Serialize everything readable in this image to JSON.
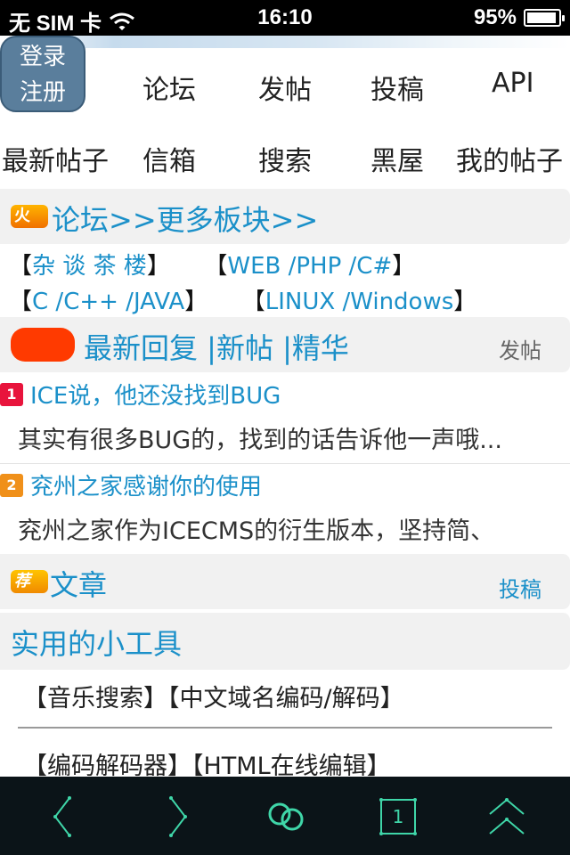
{
  "status": {
    "carrier": "无 SIM 卡",
    "time": "16:10",
    "battery": "95%",
    "battery_level": 0.95
  },
  "auth": {
    "login": "登录",
    "register": "注册"
  },
  "nav_row1": [
    "论坛",
    "发帖",
    "投稿",
    "API"
  ],
  "nav_row2": [
    "最新帖子",
    "信箱",
    "搜索",
    "黑屋",
    "我的帖子"
  ],
  "forum": {
    "badge": "火",
    "title": "论坛>>更多板块>>",
    "boards": [
      "杂 谈 茶 楼",
      "WEB /PHP /C#",
      "C /C++ /JAVA",
      "LINUX /Windows"
    ]
  },
  "hot": {
    "tabs": "最新回复 |新帖 |精华",
    "action": "发帖",
    "posts": [
      {
        "rank": "1",
        "title": "ICE说，他还没找到BUG",
        "excerpt": "其实有很多BUG的，找到的话告诉他一声哦..."
      },
      {
        "rank": "2",
        "title": "兖州之家感谢你的使用",
        "excerpt": "兖州之家作为ICECMS的衍生版本，坚持简、"
      }
    ]
  },
  "articles": {
    "badge": "荐",
    "title": "文章",
    "action": "投稿"
  },
  "tools": {
    "title": "实用的小工具",
    "row1": "【音乐搜索】【中文域名编码/解码】",
    "row2": "【编码解码器】【HTML在线编辑】"
  },
  "toolbar": {
    "page_count": "1"
  },
  "colors": {
    "accent": "#1b90c9",
    "toolbar_icon": "#3fd6a8",
    "login_bg": "#5a7e9c"
  }
}
